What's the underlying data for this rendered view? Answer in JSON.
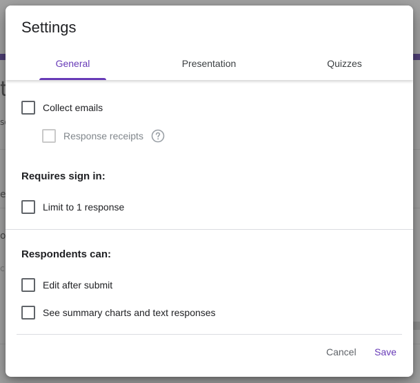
{
  "dialog": {
    "title": "Settings",
    "tabs": [
      {
        "label": "General",
        "active": true
      },
      {
        "label": "Presentation",
        "active": false
      },
      {
        "label": "Quizzes",
        "active": false
      }
    ],
    "options": {
      "collect_emails": {
        "label": "Collect emails",
        "checked": false
      },
      "response_receipts": {
        "label": "Response receipts",
        "checked": false,
        "disabled": true
      },
      "limit_response": {
        "label": "Limit to 1 response",
        "checked": false
      },
      "edit_after_submit": {
        "label": "Edit after submit",
        "checked": false
      },
      "see_summary": {
        "label": "See summary charts and text responses",
        "checked": false
      }
    },
    "sections": {
      "requires_sign_in": "Requires sign in:",
      "respondents_can": "Respondents can:"
    },
    "actions": {
      "cancel": "Cancel",
      "save": "Save"
    },
    "colors": {
      "accent": "#673ab7",
      "text": "#202124",
      "muted": "#5f6368"
    }
  }
}
